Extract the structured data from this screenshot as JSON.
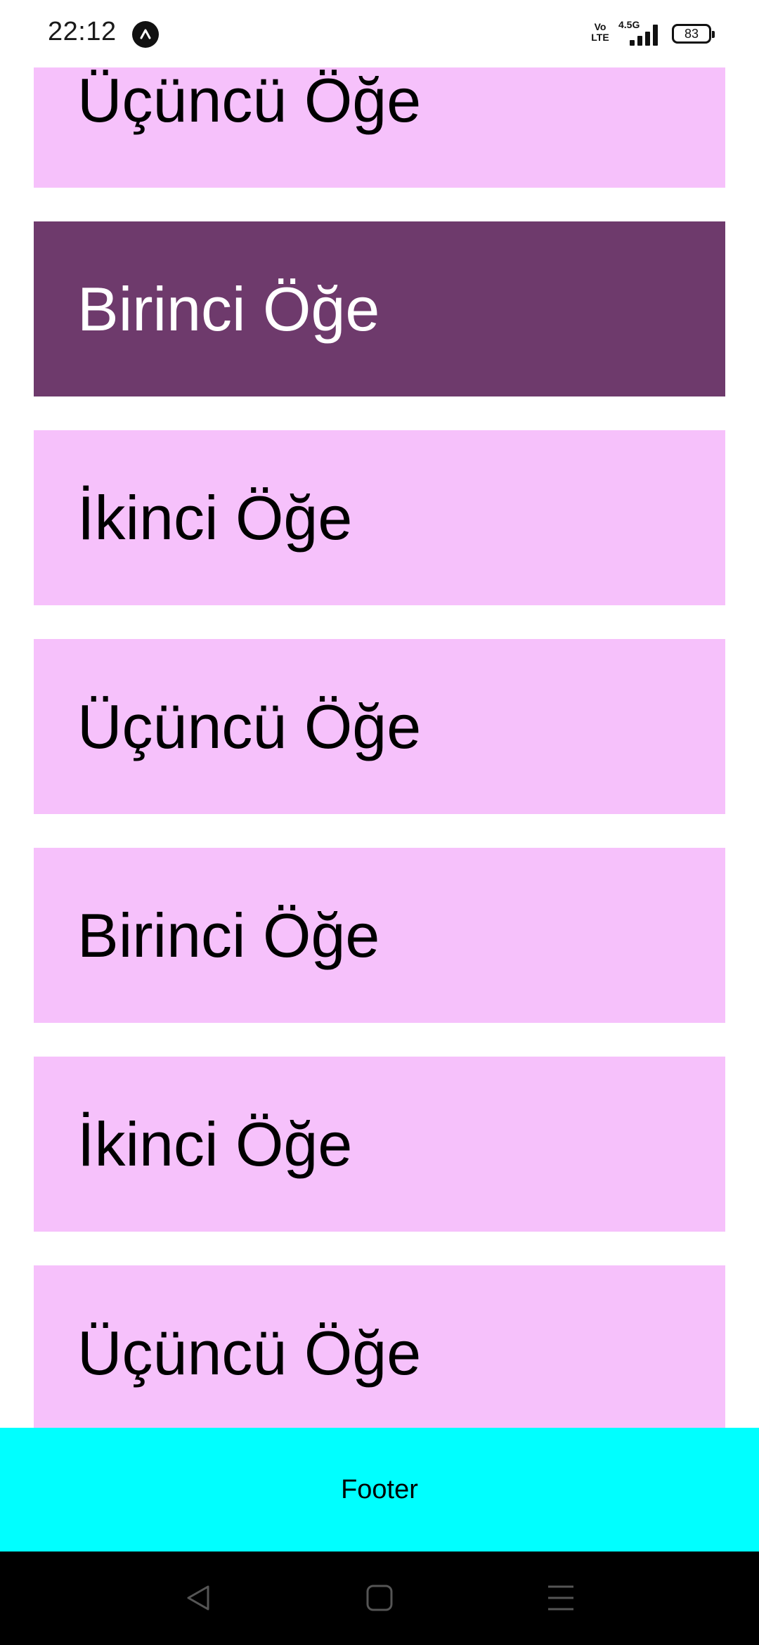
{
  "status_bar": {
    "time": "22:12",
    "network_type": "4.5G",
    "volte": "Vo LTE",
    "battery": "83",
    "app_icon": "up-arrow-badge-icon"
  },
  "list": {
    "items": [
      {
        "label": "Üçüncü Öğe",
        "selected": false,
        "partial": true
      },
      {
        "label": "Birinci Öğe",
        "selected": true
      },
      {
        "label": "İkinci Öğe",
        "selected": false
      },
      {
        "label": "Üçüncü Öğe",
        "selected": false
      },
      {
        "label": "Birinci Öğe",
        "selected": false
      },
      {
        "label": "İkinci Öğe",
        "selected": false
      },
      {
        "label": "Üçüncü Öğe",
        "selected": false
      }
    ]
  },
  "footer": {
    "label": "Footer"
  },
  "nav_bar": {
    "back": "back-icon",
    "home": "home-icon",
    "recents": "recents-icon"
  },
  "colors": {
    "item_bg": "#f6c1fb",
    "item_selected_bg": "#6e3a6c",
    "footer_bg": "#00ffff"
  }
}
